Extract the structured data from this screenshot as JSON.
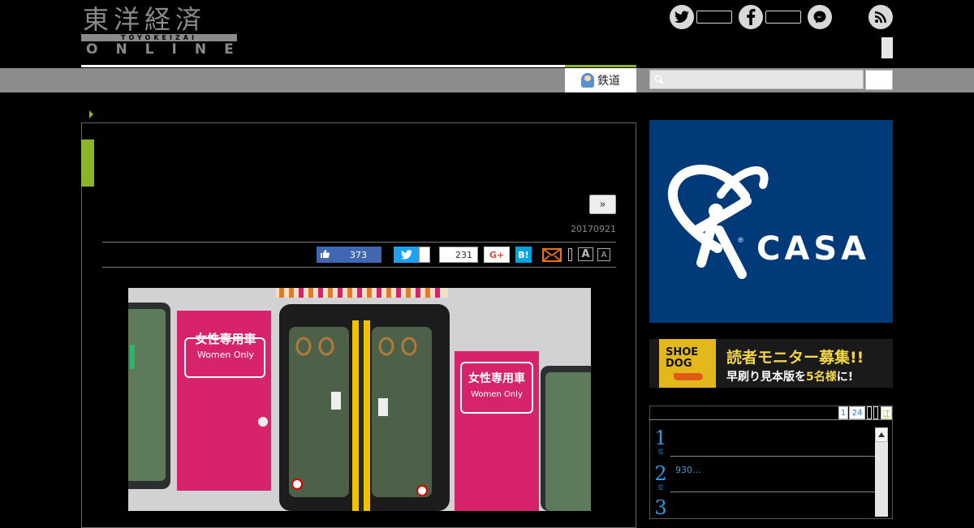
{
  "header": {
    "logo_kanji": "東洋経済",
    "logo_romaji": "TOYOKEIZAI",
    "logo_online": "ONLINE",
    "social": [
      "twitter-icon",
      "facebook-icon",
      "messenger-icon",
      "rss-icon"
    ]
  },
  "nav": {
    "active_tab": "鉄道",
    "search_placeholder": ""
  },
  "article": {
    "next_label": "»",
    "date": "20170921",
    "share": {
      "facebook_like_count": "373",
      "hatena_count": "231",
      "google_plus_label": "G+",
      "hatena_label": "B!",
      "font_large": "A",
      "font_small": "A"
    },
    "photo": {
      "sign_jp": "女性専用車",
      "sign_en": "Women Only"
    }
  },
  "sidebar": {
    "ad_casa": {
      "brand": "CASA",
      "reg": "®"
    },
    "ad_book": {
      "cover_title_1": "SHOE",
      "cover_title_2": "DOG",
      "headline": "読者モニター募集!!",
      "sub_pre": "早刷り見本版を",
      "sub_highlight": "5名様",
      "sub_post": "に!"
    },
    "ranking": {
      "pages": [
        "1",
        "24",
        "",
        "",
        "江"
      ],
      "items": [
        {
          "rank": "1",
          "suffix": "位",
          "text": ""
        },
        {
          "rank": "2",
          "suffix": "位",
          "text": "930..."
        },
        {
          "rank": "3",
          "suffix": "位",
          "text": ""
        }
      ]
    }
  },
  "colors": {
    "accent_green": "#8ab52a",
    "casa_blue": "#003a78",
    "train_pink": "#d6236b",
    "train_door_yellow": "#f2c200"
  }
}
